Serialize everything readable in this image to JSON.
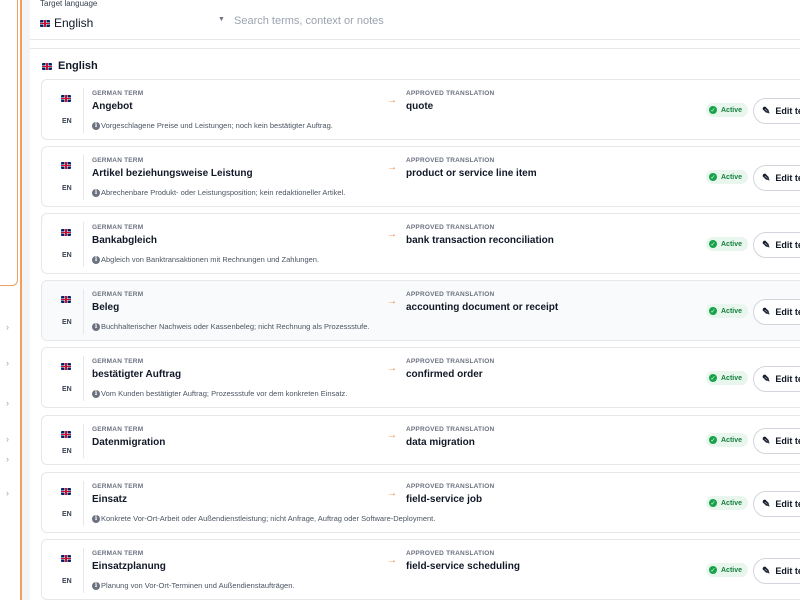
{
  "filter": {
    "language_label": "Target language",
    "language_value": "English",
    "search_placeholder": "Search terms, context or notes"
  },
  "section": {
    "title": "English"
  },
  "labels": {
    "source": "GERMAN TERM",
    "target": "APPROVED TRANSLATION",
    "edit": "Edit term"
  },
  "icons": {
    "flag": "uk-flag-icon",
    "info": "info-icon",
    "check": "check-circle-icon",
    "edit": "pencil-icon",
    "arrow": "arrow-right-icon",
    "caret": "caret-down-icon"
  },
  "colors": {
    "accent": "#f0883e",
    "active": "#15803d"
  },
  "terms": [
    {
      "lang": "EN",
      "source": "Angebot",
      "target": "quote",
      "note": "Vorgeschlagene Preise und Leistungen; noch kein bestätigter Auftrag.",
      "status": "Active"
    },
    {
      "lang": "EN",
      "source": "Artikel beziehungsweise Leistung",
      "target": "product or service line item",
      "note": "Abrechenbare Produkt- oder Leistungsposition; kein redaktioneller Artikel.",
      "status": "Active"
    },
    {
      "lang": "EN",
      "source": "Bankabgleich",
      "target": "bank transaction reconciliation",
      "note": "Abgleich von Banktransaktionen mit Rechnungen und Zahlungen.",
      "status": "Active"
    },
    {
      "lang": "EN",
      "source": "Beleg",
      "target": "accounting document or receipt",
      "note": "Buchhalterischer Nachweis oder Kassenbeleg; nicht Rechnung als Prozessstufe.",
      "status": "Active"
    },
    {
      "lang": "EN",
      "source": "bestätigter Auftrag",
      "target": "confirmed order",
      "note": "Vom Kunden bestätigter Auftrag; Prozessstufe vor dem konkreten Einsatz.",
      "status": "Active"
    },
    {
      "lang": "EN",
      "source": "Datenmigration",
      "target": "data migration",
      "note": "",
      "status": "Active"
    },
    {
      "lang": "EN",
      "source": "Einsatz",
      "target": "field-service job",
      "note": "Konkrete Vor-Ort-Arbeit oder Außendienstleistung; nicht Anfrage, Auftrag oder Software-Deployment.",
      "status": "Active"
    },
    {
      "lang": "EN",
      "source": "Einsatzplanung",
      "target": "field-service scheduling",
      "note": "Planung von Vor-Ort-Terminen und Außendienstaufträgen.",
      "status": "Active"
    }
  ]
}
